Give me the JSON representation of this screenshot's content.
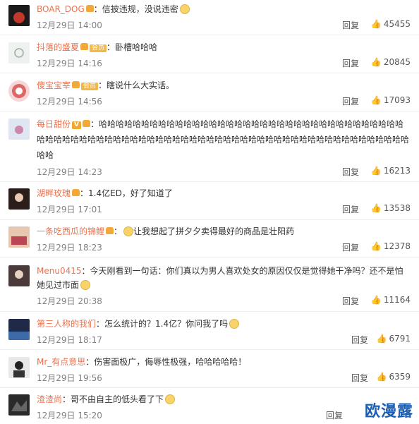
{
  "reply_label": "回复",
  "comments": [
    {
      "username": "BOAR_DOG",
      "text": "：信披违规，没说违密",
      "date": "12月29日 14:00",
      "likes": "45455",
      "badge": "",
      "emoji": true
    },
    {
      "username": "抖落的盛夏",
      "text": "：卧槽哈哈哈",
      "date": "12月29日 14:16",
      "likes": "20845",
      "badge": "会员",
      "emoji": false
    },
    {
      "username": "傻宝宝宰",
      "text": "：瞎说什么大实话。",
      "date": "12月29日 14:56",
      "likes": "17093",
      "badge": "会员",
      "emoji": false
    },
    {
      "username": "每日甜份",
      "text": "：哈哈哈哈哈哈哈哈哈哈哈哈哈哈哈哈哈哈哈哈哈哈哈哈哈哈哈哈哈哈哈哈哈哈哈哈哈哈哈哈哈哈哈哈哈哈哈哈哈哈哈哈哈哈哈哈哈哈哈哈哈哈哈哈哈哈哈哈哈哈哈哈哈哈哈哈哈哈哈哈哈哈",
      "date": "12月29日 14:23",
      "likes": "16213",
      "badge": "V",
      "emoji": false
    },
    {
      "username": "湖畔玫瑰",
      "text": "：1.4亿ED，好了知道了",
      "date": "12月29日 17:01",
      "likes": "13538",
      "badge": "",
      "emoji": false
    },
    {
      "username": "一条吃西瓜的锦鲤",
      "text": "让我想起了拼夕夕卖得最好的商品是壮阳药",
      "date": "12月29日 18:23",
      "likes": "12378",
      "badge": "",
      "emoji": true
    },
    {
      "username": "Menu0415",
      "text": "：今天刚看到一句话：你们真以为男人喜欢处女的原因仅仅是觉得她干净吗？还不是怕她见过市面",
      "date": "12月29日 20:38",
      "likes": "11164",
      "badge": "",
      "emoji": true
    },
    {
      "username": "第三人称的我们",
      "text": "：怎么统计的？1.4亿？你问我了吗",
      "date": "12月29日 18:17",
      "likes": "6791",
      "badge": "",
      "emoji": true
    },
    {
      "username": "Mr_有点意思",
      "text": "：伤害面极广，侮辱性极强，哈哈哈哈哈！",
      "date": "12月29日 19:56",
      "likes": "6359",
      "badge": "",
      "emoji": false
    },
    {
      "username": "渣渣尚",
      "text": "：哥不由自主的低头看了下",
      "date": "12月29日 15:20",
      "likes": "",
      "badge": "",
      "emoji": true
    }
  ],
  "watermark": "欧漫露"
}
